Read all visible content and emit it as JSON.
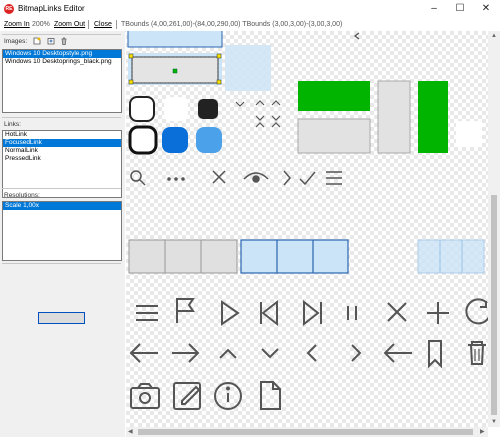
{
  "window": {
    "title": "BitmapLinks Editor",
    "app_icon_text": "RE",
    "minimize_glyph": "–",
    "maximize_glyph": "☐",
    "close_glyph": "✕"
  },
  "toolbar": {
    "zoom_in": "Zoom In",
    "zoom_level": "200%",
    "zoom_out": "Zoom Out",
    "close": "Close",
    "bounds_text": "TBounds (4,00,261,00)-(84,00,290,00) TBounds (3,00,3,00)-(3,00,3,00)"
  },
  "images": {
    "label": "Images:",
    "items": [
      "Windows 10 Desktopstyle.png",
      "Windows 10 Desktoprings_black.png"
    ],
    "selected_index": 0
  },
  "links": {
    "label": "Links:",
    "items": [
      "HotLink",
      "FocusedLink",
      "NormalLink",
      "PressedLink"
    ],
    "selected_index": 1
  },
  "resolutions": {
    "label": "Resolutions:",
    "items": [
      "Scale 1,00x"
    ],
    "selected_index": 0
  },
  "colors": {
    "selection": "#0078d7",
    "accent_green": "#00b400",
    "accent_blue": "#0a6fd8",
    "light_blue": "#4ca2ea",
    "outline_blue": "#2a66b0",
    "glyph_gray": "#555555",
    "handle_yellow": "#f5e000"
  },
  "icons": {
    "tool_icons": [
      "new-image-icon",
      "add-image-icon",
      "delete-image-icon"
    ],
    "row1_glyphs": [
      "search-icon",
      "more-icon",
      "close-icon",
      "eye-icon",
      "chevron-right-icon",
      "check-icon",
      "menu-icon"
    ],
    "row2_glyphs": [
      "menu-icon",
      "flag-icon",
      "play-icon",
      "skip-back-icon",
      "skip-forward-icon",
      "pause-icon",
      "close-icon",
      "add-icon",
      "refresh-icon"
    ],
    "row3_glyphs": [
      "arrow-left-icon",
      "arrow-right-icon",
      "chevron-up-icon",
      "chevron-down-icon",
      "chevron-left-icon",
      "chevron-right-icon",
      "back-arrow-icon",
      "bookmark-icon",
      "trash-icon"
    ],
    "row4_glyphs": [
      "camera-icon",
      "edit-icon",
      "info-icon",
      "document-icon"
    ]
  }
}
